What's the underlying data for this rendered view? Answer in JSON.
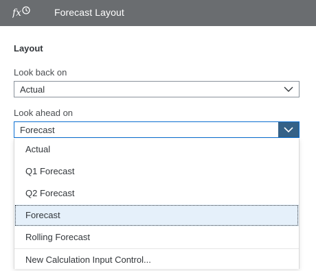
{
  "header": {
    "title": "Forecast Layout",
    "icon": "fx-clock-icon"
  },
  "section": {
    "title": "Layout"
  },
  "look_back": {
    "label": "Look back on",
    "value": "Actual"
  },
  "look_ahead": {
    "label": "Look ahead on",
    "value": "Forecast",
    "options": [
      "Actual",
      "Q1 Forecast",
      "Q2 Forecast",
      "Forecast",
      "Rolling Forecast"
    ],
    "selected_option": "Forecast",
    "footer_option": "New Calculation Input Control..."
  },
  "colors": {
    "header_bg": "#6a6d70",
    "accent": "#346187",
    "selected_bg": "#e5f0fa"
  }
}
